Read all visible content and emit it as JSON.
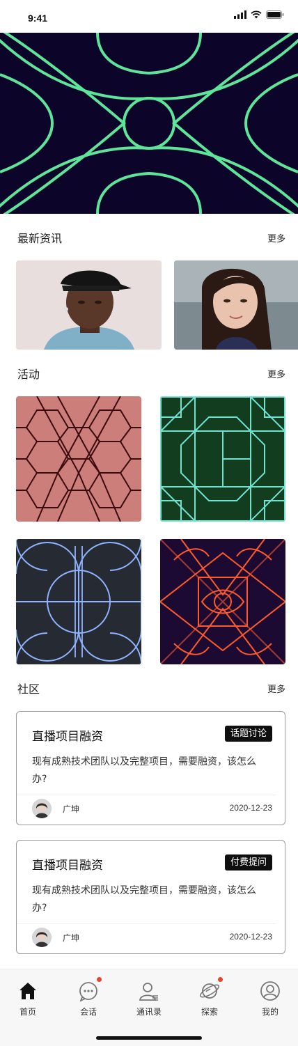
{
  "status_bar": {
    "time": "9:41",
    "icons": [
      "signal-icon",
      "wifi-icon",
      "battery-icon"
    ]
  },
  "hero": {
    "icon": "geometric-pattern",
    "colors": {
      "background": "#0d0529",
      "stroke": "#5ee59a"
    }
  },
  "news": {
    "title": "最新资讯",
    "more": "更多",
    "items": [
      {
        "image": "portrait-man-cap"
      },
      {
        "image": "portrait-woman"
      }
    ]
  },
  "activity": {
    "title": "活动",
    "more": "更多",
    "tiles": [
      {
        "pattern": "hexagon-lattice",
        "background": "#cc7e7a",
        "stroke": "#3b0a0c"
      },
      {
        "pattern": "square-frames",
        "background": "#133d1f",
        "stroke": "#6fe3d2"
      },
      {
        "pattern": "arches-circle",
        "background": "#262b33",
        "stroke": "#8fb3ff"
      },
      {
        "pattern": "diamond-eye",
        "background": "#1d0a33",
        "stroke": "#ff5a2b"
      }
    ]
  },
  "community": {
    "title": "社区",
    "more": "更多",
    "posts": [
      {
        "title": "直播项目融资",
        "tag": "话题讨论",
        "body": "现有成熟技术团队以及完整项目，需要融资，该怎么办?",
        "author": "广坤",
        "date": "2020-12-23"
      },
      {
        "title": "直播项目融资",
        "tag": "付费提问",
        "body": "现有成熟技术团队以及完整项目，需要融资，该怎么办?",
        "author": "广坤",
        "date": "2020-12-23"
      }
    ]
  },
  "tab_bar": {
    "items": [
      {
        "label": "首页",
        "icon": "home-icon",
        "active": true,
        "badge": false
      },
      {
        "label": "会话",
        "icon": "chat-icon",
        "active": false,
        "badge": true
      },
      {
        "label": "通讯录",
        "icon": "contacts-icon",
        "active": false,
        "badge": false
      },
      {
        "label": "探索",
        "icon": "planet-icon",
        "active": false,
        "badge": true
      },
      {
        "label": "我的",
        "icon": "profile-icon",
        "active": false,
        "badge": false
      }
    ],
    "colors": {
      "badge": "#e8442c",
      "active": "#111111",
      "inactive": "#777777"
    }
  }
}
